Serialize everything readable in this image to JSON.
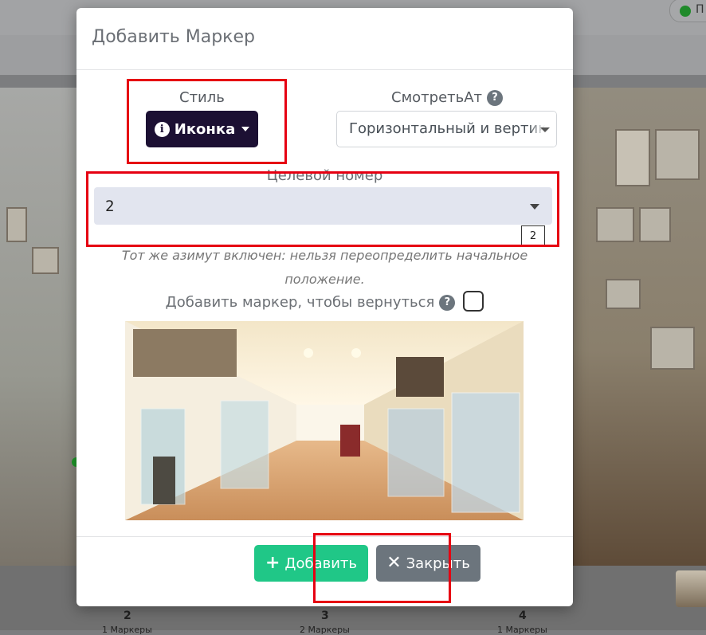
{
  "modal": {
    "title": "Добавить Маркер",
    "style_label": "Стиль",
    "style_button_label": "Иконка",
    "lookat_label": "СмотретьАт",
    "lookat_value": "Горизонтальный и вертикальный",
    "target_label": "Целевой номер",
    "target_value": "2",
    "target_count": "2",
    "note": "Тот же азимут включен: нельзя переопределить начальное положение.",
    "return_marker_label": "Добавить маркер, чтобы вернуться",
    "add_button_label": "Добавить",
    "close_button_label": "Закрыть"
  },
  "background": {
    "corner_label": "П",
    "thumbnails": [
      {
        "number": "2",
        "sub": "1 Маркеры"
      },
      {
        "number": "3",
        "sub": "2 Маркеры"
      },
      {
        "number": "4",
        "sub": "1 Маркеры"
      }
    ]
  },
  "colors": {
    "style_button": "#1c1033",
    "add_button": "#20c787",
    "close_button": "#6c757d",
    "highlight": "#e60012",
    "target_select_bg": "#e2e5ef"
  },
  "icons": {
    "style_button": "info-icon",
    "lookat_help": "question-circle-icon",
    "return_help": "question-circle-icon",
    "add_button": "plus-icon",
    "close_button": "x-icon"
  }
}
